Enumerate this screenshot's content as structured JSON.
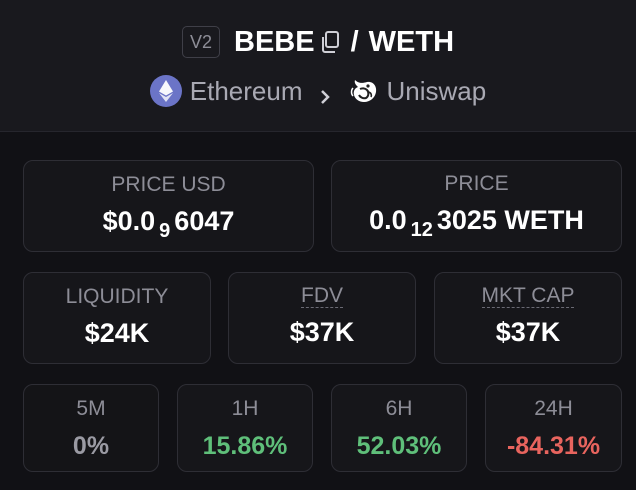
{
  "header": {
    "version": "V2",
    "base_symbol": "BEBE",
    "separator": "/",
    "quote_symbol": "WETH",
    "chain": "Ethereum",
    "dex": "Uniswap"
  },
  "price_usd": {
    "label": "PRICE USD",
    "prefix": "$0.0",
    "zeros": "9",
    "digits": "6047"
  },
  "price": {
    "label": "PRICE",
    "prefix": "0.0",
    "zeros": "12",
    "digits": "3025 WETH"
  },
  "stats": [
    {
      "label": "LIQUIDITY",
      "value": "$24K"
    },
    {
      "label": "FDV",
      "value": "$37K"
    },
    {
      "label": "MKT CAP",
      "value": "$37K"
    }
  ],
  "changes": [
    {
      "label": "5M",
      "value": "0%",
      "color": "#9a9aa3"
    },
    {
      "label": "1H",
      "value": "15.86%",
      "color": "#5fbf7a"
    },
    {
      "label": "6H",
      "value": "52.03%",
      "color": "#5fbf7a"
    },
    {
      "label": "24H",
      "value": "-84.31%",
      "color": "#e8645e"
    }
  ]
}
